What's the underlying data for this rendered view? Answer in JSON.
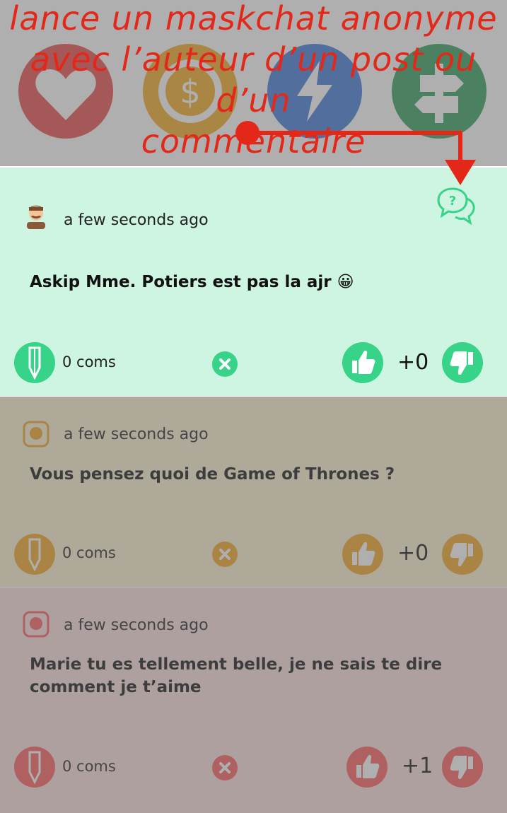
{
  "annotation": {
    "lines": [
      "lance un maskchat anonyme",
      "avec l’auteur d’un post ou d’un",
      "commentaire"
    ]
  },
  "categories": [
    {
      "icon": "heart-icon",
      "color": "#e84a4a"
    },
    {
      "icon": "coin-icon",
      "color": "#f2a91e"
    },
    {
      "icon": "lightning-icon",
      "color": "#3b78d8"
    },
    {
      "icon": "signpost-icon",
      "color": "#2e9e5a"
    }
  ],
  "posts": [
    {
      "time": "a few seconds ago",
      "text": "Askip Mme. Potiers est pas la ajr 😀",
      "coms": "0 coms",
      "score": "+0",
      "accent": "#36d388"
    },
    {
      "time": "a few seconds ago",
      "text": "Vous pensez quoi de Game of Thrones ?",
      "coms": "0 coms",
      "score": "+0",
      "accent": "#f5a623"
    },
    {
      "time": "a few seconds ago",
      "text": "Marie tu es tellement belle, je ne sais te dire comment je t’aime",
      "coms": "0 coms",
      "score": "+1",
      "accent": "#ff5a5a"
    }
  ],
  "colors": {
    "highlight_bg": "#cdf5e1",
    "annotation": "#e3281a"
  }
}
